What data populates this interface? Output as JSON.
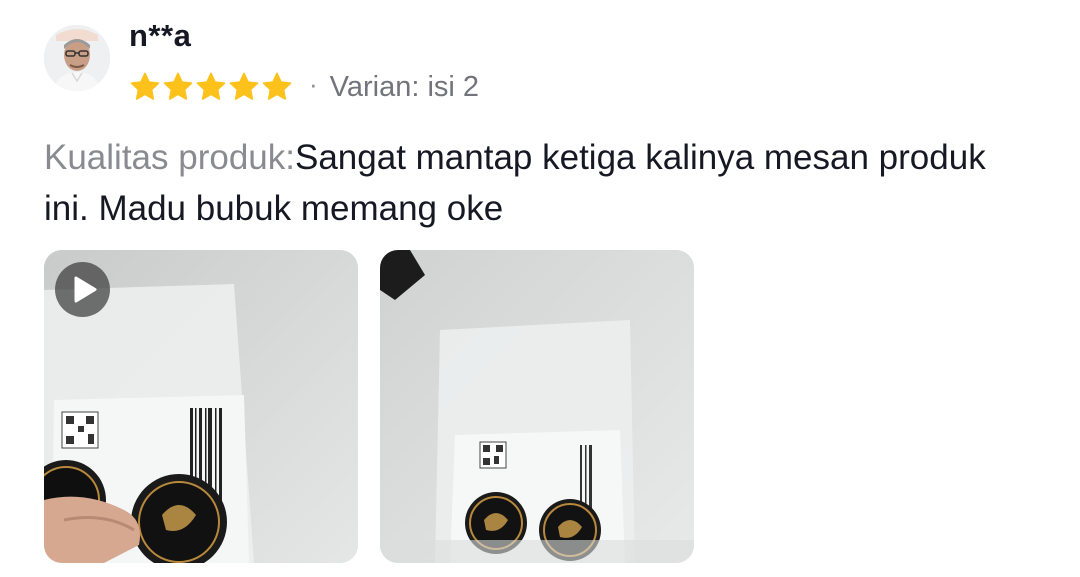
{
  "reviewer": {
    "username": "n**a",
    "avatar_icon": "user-avatar-icon",
    "rating": 5,
    "rating_max": 5
  },
  "variant": {
    "separator": "·",
    "label": "Varian: isi 2"
  },
  "review": {
    "label": "Kualitas produk:",
    "text": "Sangat mantap ketiga kalinya mesan produk ini. Madu bubuk memang oke"
  },
  "media": [
    {
      "type": "video",
      "icon": "play-icon"
    },
    {
      "type": "photo"
    }
  ],
  "colors": {
    "star": "#fcc21b",
    "label_text": "#8a8b91",
    "body_text": "#161823"
  }
}
